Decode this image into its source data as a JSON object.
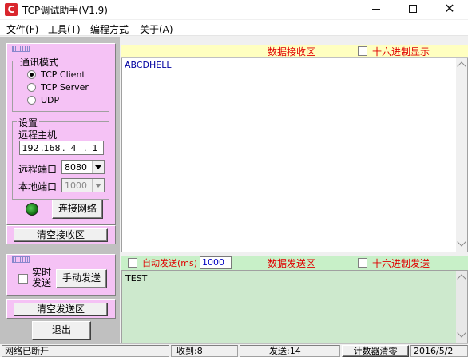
{
  "window": {
    "title": "TCP调试助手(V1.9)",
    "icon_letter": "C"
  },
  "menu": [
    {
      "label": "文件(F)"
    },
    {
      "label": "工具(T)"
    },
    {
      "label": "编程方式"
    },
    {
      "label": "关于(A)"
    }
  ],
  "comm_mode": {
    "legend": "通讯模式",
    "options": [
      {
        "label": "TCP Client",
        "selected": true
      },
      {
        "label": "TCP Server",
        "selected": false
      },
      {
        "label": "UDP",
        "selected": false
      }
    ]
  },
  "settings": {
    "legend": "设置",
    "remote_host_label": "远程主机",
    "ip": [
      "192",
      "168",
      "4",
      "1"
    ],
    "remote_port_label": "远程端口",
    "remote_port": "8080",
    "local_port_label": "本地端口",
    "local_port": "1000",
    "connect_button": "连接网络",
    "led_status": "connected"
  },
  "clear_recv_button": "清空接收区",
  "realtime_send_label": "实时\n发送",
  "manual_send_button": "手动发送",
  "clear_send_button": "清空发送区",
  "exit_button": "退出",
  "receive": {
    "title": "数据接收区",
    "hex_label": "十六进制显示",
    "text": "ABCDHELL"
  },
  "send": {
    "auto_label": "自动发送(ms)",
    "interval": "1000",
    "title": "数据发送区",
    "hex_label": "十六进制发送",
    "text": "TEST"
  },
  "status": {
    "network": "网络已断开",
    "received": "收到:8",
    "sent": "发送:14",
    "reset_counter": "计数器清零",
    "date": "2016/5/2"
  },
  "colors": {
    "left_panel_bg": "#f5c2f5",
    "recv_header": "#ffffc0",
    "send_bg": "#cde9cd",
    "title_red": "#e00000"
  }
}
